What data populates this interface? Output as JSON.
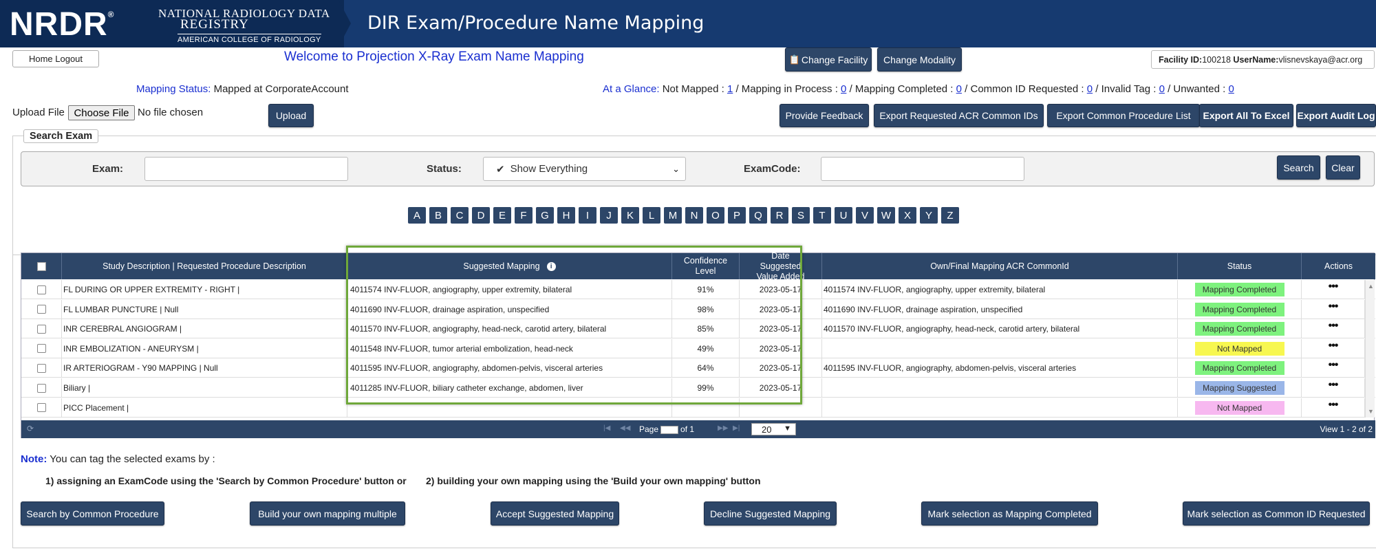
{
  "header": {
    "logo": "NRDR",
    "registry_line1": "NATIONAL RADIOLOGY DATA",
    "registry_line2": "REGISTRY",
    "registry_line3": "AMERICAN COLLEGE OF RADIOLOGY",
    "title": "DIR Exam/Procedure Name Mapping"
  },
  "topbar": {
    "home_logout": "Home  Logout",
    "welcome": "Welcome to Projection X-Ray Exam Name Mapping",
    "change_facility": "Change Facility",
    "change_modality": "Change Modality",
    "facility_id_label": "Facility ID:",
    "facility_id": "100218",
    "username_label": "UserName:",
    "username": "vlisnevskaya@acr.org"
  },
  "mapping_status": {
    "label": "Mapping Status:",
    "value": "Mapped at CorporateAccount"
  },
  "glance": {
    "label": "At a Glance:",
    "not_mapped_label": "Not Mapped :",
    "not_mapped": "1",
    "in_process_label": "/ Mapping in Process :",
    "in_process": "0",
    "completed_label": "/ Mapping Completed :",
    "completed": "0",
    "common_id_label": "/ Common ID Requested :",
    "common_id": "0",
    "invalid_label": "/ Invalid Tag :",
    "invalid": "0",
    "unwanted_label": "/ Unwanted :",
    "unwanted": "0"
  },
  "upload": {
    "label": "Upload File",
    "choose": "Choose File",
    "no_file": "No file chosen",
    "button": "Upload"
  },
  "toolbar": {
    "feedback": "Provide Feedback",
    "export_requested": "Export Requested ACR Common IDs",
    "export_common": "Export Common Procedure List",
    "export_all": "Export All To Excel",
    "export_audit": "Export Audit Log"
  },
  "search": {
    "legend": "Search Exam",
    "exam_label": "Exam:",
    "status_label": "Status:",
    "status_value": "Show Everything",
    "examcode_label": "ExamCode:",
    "search_button": "Search",
    "clear_button": "Clear"
  },
  "alphabet": [
    "A",
    "B",
    "C",
    "D",
    "E",
    "F",
    "G",
    "H",
    "I",
    "J",
    "K",
    "L",
    "M",
    "N",
    "O",
    "P",
    "Q",
    "R",
    "S",
    "T",
    "U",
    "V",
    "W",
    "X",
    "Y",
    "Z"
  ],
  "grid": {
    "headers": {
      "study": "Study Description | Requested Procedure Description",
      "suggested": "Suggested Mapping",
      "confidence": "Confidence Level",
      "date_suggested": "Date Suggested Value Added",
      "own_final": "Own/Final Mapping ACR CommonId",
      "status": "Status",
      "actions": "Actions"
    },
    "rows": [
      {
        "study": "FL DURING OR UPPER EXTREMITY - RIGHT |",
        "suggested": "4011574 INV-FLUOR, angiography, upper extremity, bilateral",
        "confidence": "91%",
        "date": "2023-05-17",
        "final": "4011574 INV-FLUOR, angiography, upper extremity, bilateral",
        "status": "Mapping Completed",
        "status_color": "#7ef27e"
      },
      {
        "study": "FL LUMBAR PUNCTURE | Null",
        "suggested": "4011690 INV-FLUOR, drainage aspiration, unspecified",
        "confidence": "98%",
        "date": "2023-05-17",
        "final": "4011690 INV-FLUOR, drainage aspiration, unspecified",
        "status": "Mapping Completed",
        "status_color": "#7ef27e"
      },
      {
        "study": "INR CEREBRAL ANGIOGRAM |",
        "suggested": "4011570 INV-FLUOR, angiography, head-neck, carotid artery, bilateral",
        "confidence": "85%",
        "date": "2023-05-17",
        "final": "4011570 INV-FLUOR, angiography, head-neck, carotid artery, bilateral",
        "status": "Mapping Completed",
        "status_color": "#7ef27e"
      },
      {
        "study": "INR EMBOLIZATION - ANEURYSM |",
        "suggested": "4011548 INV-FLUOR, tumor arterial embolization, head-neck",
        "confidence": "49%",
        "date": "2023-05-17",
        "final": "",
        "status": "Not Mapped",
        "status_color": "#f7f750"
      },
      {
        "study": "IR ARTERIOGRAM - Y90 MAPPING | Null",
        "suggested": "4011595 INV-FLUOR, angiography, abdomen-pelvis, visceral arteries",
        "confidence": "64%",
        "date": "2023-05-17",
        "final": "4011595 INV-FLUOR, angiography, abdomen-pelvis, visceral arteries",
        "status": "Mapping Completed",
        "status_color": "#7ef27e"
      },
      {
        "study": "Biliary |",
        "suggested": "4011285 INV-FLUOR, biliary catheter exchange, abdomen, liver",
        "confidence": "99%",
        "date": "2023-05-17",
        "final": "",
        "status": "Mapping Suggested",
        "status_color": "#9ab6e8"
      },
      {
        "study": "PICC Placement |",
        "suggested": "",
        "confidence": "",
        "date": "",
        "final": "",
        "status": "Not Mapped",
        "status_color": "#f7b8f0"
      }
    ],
    "footer": {
      "page_label": "Page",
      "of_label": "of 1",
      "page_size": "20",
      "view": "View 1 - 2 of 2"
    }
  },
  "note": {
    "label": "Note:",
    "text": "You can tag the selected exams by :",
    "step1": "1) assigning an ExamCode using the 'Search by Common Procedure' button or",
    "step2": "2) building your own mapping using the 'Build your own mapping' button"
  },
  "bottom_buttons": {
    "search_common": "Search by Common Procedure",
    "build_own": "Build your own mapping multiple",
    "accept": "Accept Suggested Mapping",
    "decline": "Decline Suggested Mapping",
    "mark_completed": "Mark selection as Mapping Completed",
    "mark_common": "Mark selection as Common ID Requested"
  }
}
